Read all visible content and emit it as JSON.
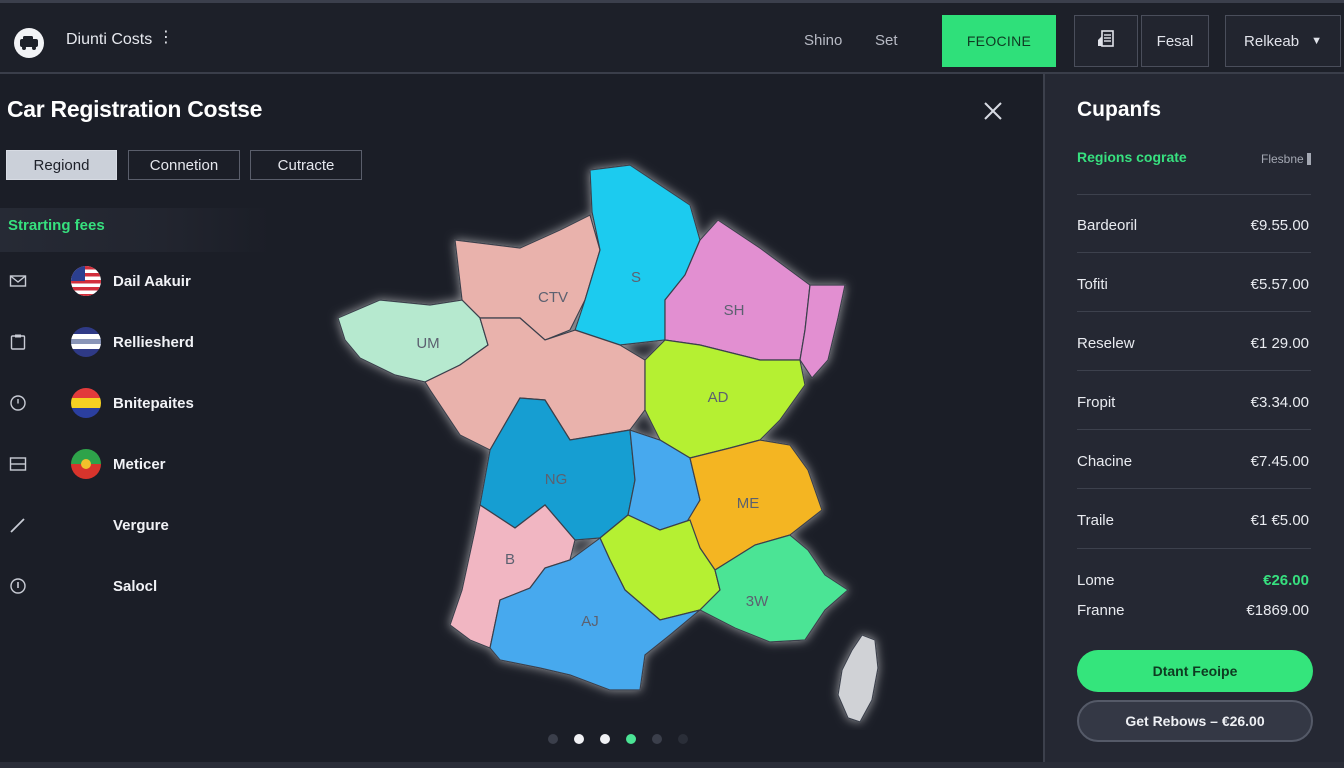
{
  "header": {
    "app_title": "Diunti Costs",
    "links": [
      "Shino",
      "Set"
    ],
    "primary_button": "FEOCINE",
    "box_button": "Fesal",
    "select_label": "Relkeab"
  },
  "panel": {
    "title": "Car Registration Costse",
    "tabs": [
      "Regiond",
      "Connetion",
      "Cutracte"
    ],
    "active_tab": "Regiond",
    "section_label": "Strarting fees",
    "items": [
      {
        "name": "Dail Aakuir",
        "icon": "mail-icon",
        "flag": "us-flag"
      },
      {
        "name": "Relliesherd",
        "icon": "clipboard-icon",
        "flag": "striped-flag"
      },
      {
        "name": "Bnitepaites",
        "icon": "clock-icon",
        "flag": "tricolor-flag"
      },
      {
        "name": "Meticer",
        "icon": "card-icon",
        "flag": "green-red-flag"
      },
      {
        "name": "Vergure",
        "icon": "pencil-icon",
        "flag": ""
      },
      {
        "name": "Salocl",
        "icon": "info-icon",
        "flag": ""
      }
    ]
  },
  "map": {
    "regions": [
      {
        "label": "CTV",
        "color": "#e9b2ac"
      },
      {
        "label": "S",
        "color": "#1bcbef"
      },
      {
        "label": "SH",
        "color": "#e28fd1"
      },
      {
        "label": "UM",
        "color": "#b6e9cf"
      },
      {
        "label": "AD",
        "color": "#b5f030"
      },
      {
        "label": "NG",
        "color": "#149ed2"
      },
      {
        "label": "ME",
        "color": "#f4b523"
      },
      {
        "label": "B",
        "color": "#f1b6c2"
      },
      {
        "label": "AJ",
        "color": "#47a9ee"
      },
      {
        "label": "3W",
        "color": "#4be495"
      }
    ],
    "carousel": {
      "count": 6,
      "active": 3
    }
  },
  "costs": {
    "title": "Cupanfs",
    "subtitle": "Regions cograte",
    "sort_label": "Flesbne",
    "rows": [
      {
        "name": "Bardeoril",
        "value": "€9.55.00"
      },
      {
        "name": "Tofiti",
        "value": "€5.57.00"
      },
      {
        "name": "Reselew",
        "value": "€1 29.00"
      },
      {
        "name": "Fropit",
        "value": "€3.34.00"
      },
      {
        "name": "Chacine",
        "value": "€7.45.00"
      },
      {
        "name": "Traile",
        "value": "€1 €5.00"
      }
    ],
    "total_rows": [
      {
        "name": "Lome",
        "value": "€26.00"
      },
      {
        "name": "Franne",
        "value": "€1869.00"
      }
    ],
    "primary_button": "Dtant Feoipe",
    "secondary_button": "Get Rebows – €26.00"
  },
  "colors": {
    "accent_green": "#34e57c",
    "background": "#1b1e27",
    "panel": "#252833"
  }
}
